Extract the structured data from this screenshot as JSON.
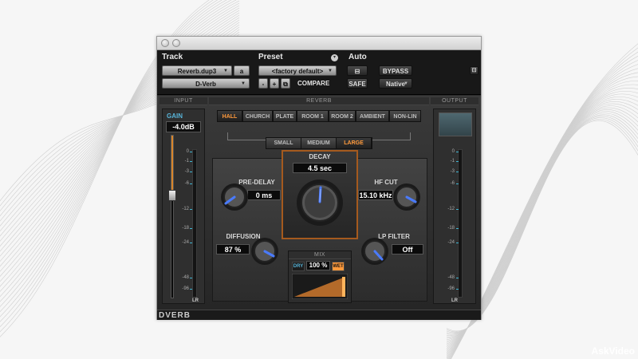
{
  "track": {
    "title": "Track",
    "track_name": "Reverb.dup3",
    "channel": "a",
    "plugin": "D-Verb"
  },
  "preset": {
    "title": "Preset",
    "current": "<factory default>",
    "minus": "-",
    "plus": "+",
    "compare": "COMPARE"
  },
  "auto": {
    "title": "Auto",
    "bypass": "BYPASS",
    "safe": "SAFE",
    "native": "Native"
  },
  "input": {
    "header": "INPUT",
    "gain_label": "GAIN",
    "gain_value": "-4.0dB",
    "fader_level": 0.63,
    "lr": "LR"
  },
  "output": {
    "header": "OUTPUT",
    "lr": "LR"
  },
  "meter_scale": [
    "0",
    "-1",
    "-3",
    "-6",
    "-12",
    "-18",
    "-24",
    "-48",
    "-96"
  ],
  "reverb": {
    "header": "REVERB",
    "algorithms": [
      "HALL",
      "CHURCH",
      "PLATE",
      "ROOM 1",
      "ROOM 2",
      "AMBIENT",
      "NON-LIN"
    ],
    "selected_algorithm": "HALL",
    "sizes": [
      "SMALL",
      "MEDIUM",
      "LARGE"
    ],
    "selected_size": "LARGE"
  },
  "params": {
    "decay_label": "DECAY",
    "decay_value": "4.5 sec",
    "predelay_label": "PRE-DELAY",
    "predelay_value": "0 ms",
    "hfcut_label": "HF CUT",
    "hfcut_value": "15.10 kHz",
    "diffusion_label": "DIFFUSION",
    "diffusion_value": "87 %",
    "lpfilter_label": "LP FILTER",
    "lpfilter_value": "Off"
  },
  "mix": {
    "header": "MIX",
    "dry": "DRY",
    "value": "100 %",
    "wet": "WET",
    "level": 1.0
  },
  "footer": {
    "logo": "DVERB",
    "watermark": "AskVideo"
  },
  "colors": {
    "accent_orange": "#ff9a3c",
    "decay_border": "#a55a1e",
    "gain_blue": "#58b4d8",
    "knob_indicator": "#4a7bff"
  }
}
